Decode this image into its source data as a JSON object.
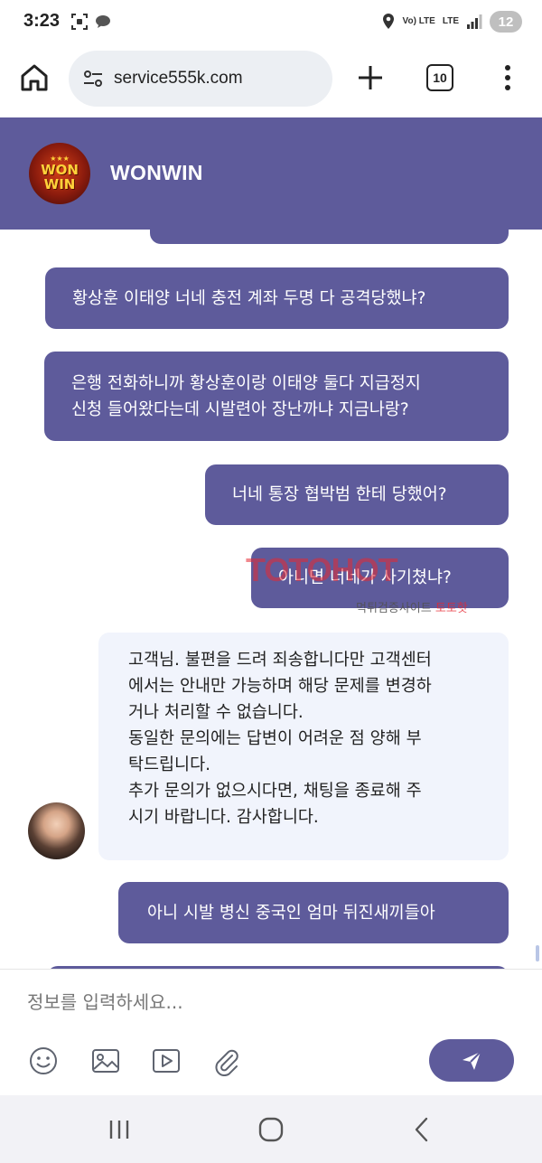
{
  "status_bar": {
    "time": "3:23",
    "talk_badge": "TALK",
    "network_label": "Vo) LTE",
    "lte_label": "LTE",
    "battery": "12"
  },
  "browser": {
    "url": "service555k.com",
    "tab_count": "10"
  },
  "chat_header": {
    "title": "WONWIN",
    "logo_line1": "WON",
    "logo_line2": "WIN"
  },
  "messages": [
    {
      "direction": "out",
      "text": ""
    },
    {
      "direction": "out",
      "text": "황상훈 이태양 너네 충전 계좌 두명 다 공격당했냐?"
    },
    {
      "direction": "out",
      "text": "은행 전화하니까 황상훈이랑 이태양 둘다 지급정지\n신청 들어왔다는데 시발련아 장난까냐 지금나랑?"
    },
    {
      "direction": "out",
      "text": "너네 통장 협박범 한테 당했어?"
    },
    {
      "direction": "out",
      "text": "아니면 너네가 사기쳤냐?"
    },
    {
      "direction": "in",
      "text": "고객님. 불편을 드려 죄송합니다만 고객센터\n에서는 안내만 가능하며 해당 문제를 변경하\n거나 처리할 수 없습니다.\n동일한 문의에는 답변이 어려운 점 양해 부\n탁드립니다.\n추가 문의가 없으시다면, 채팅을 종료해 주\n시기 바랍니다. 감사합니다."
    },
    {
      "direction": "out",
      "text": "아니 시발 병신 중국인 엄마 뒤진새끼들아"
    },
    {
      "direction": "out",
      "text": ""
    }
  ],
  "watermark": {
    "logo": "TOTOHOT",
    "sub_black": "먹튀검증사이트",
    "sub_red": "토토핫"
  },
  "composer": {
    "placeholder": "정보를 입력하세요...",
    "icons": [
      "emoji-icon",
      "image-icon",
      "video-icon",
      "attachment-icon",
      "send-icon"
    ]
  },
  "colors": {
    "brand": "#5e5b9b",
    "incoming_bubble": "#f1f4fc",
    "outgoing_text": "#ffffff"
  }
}
